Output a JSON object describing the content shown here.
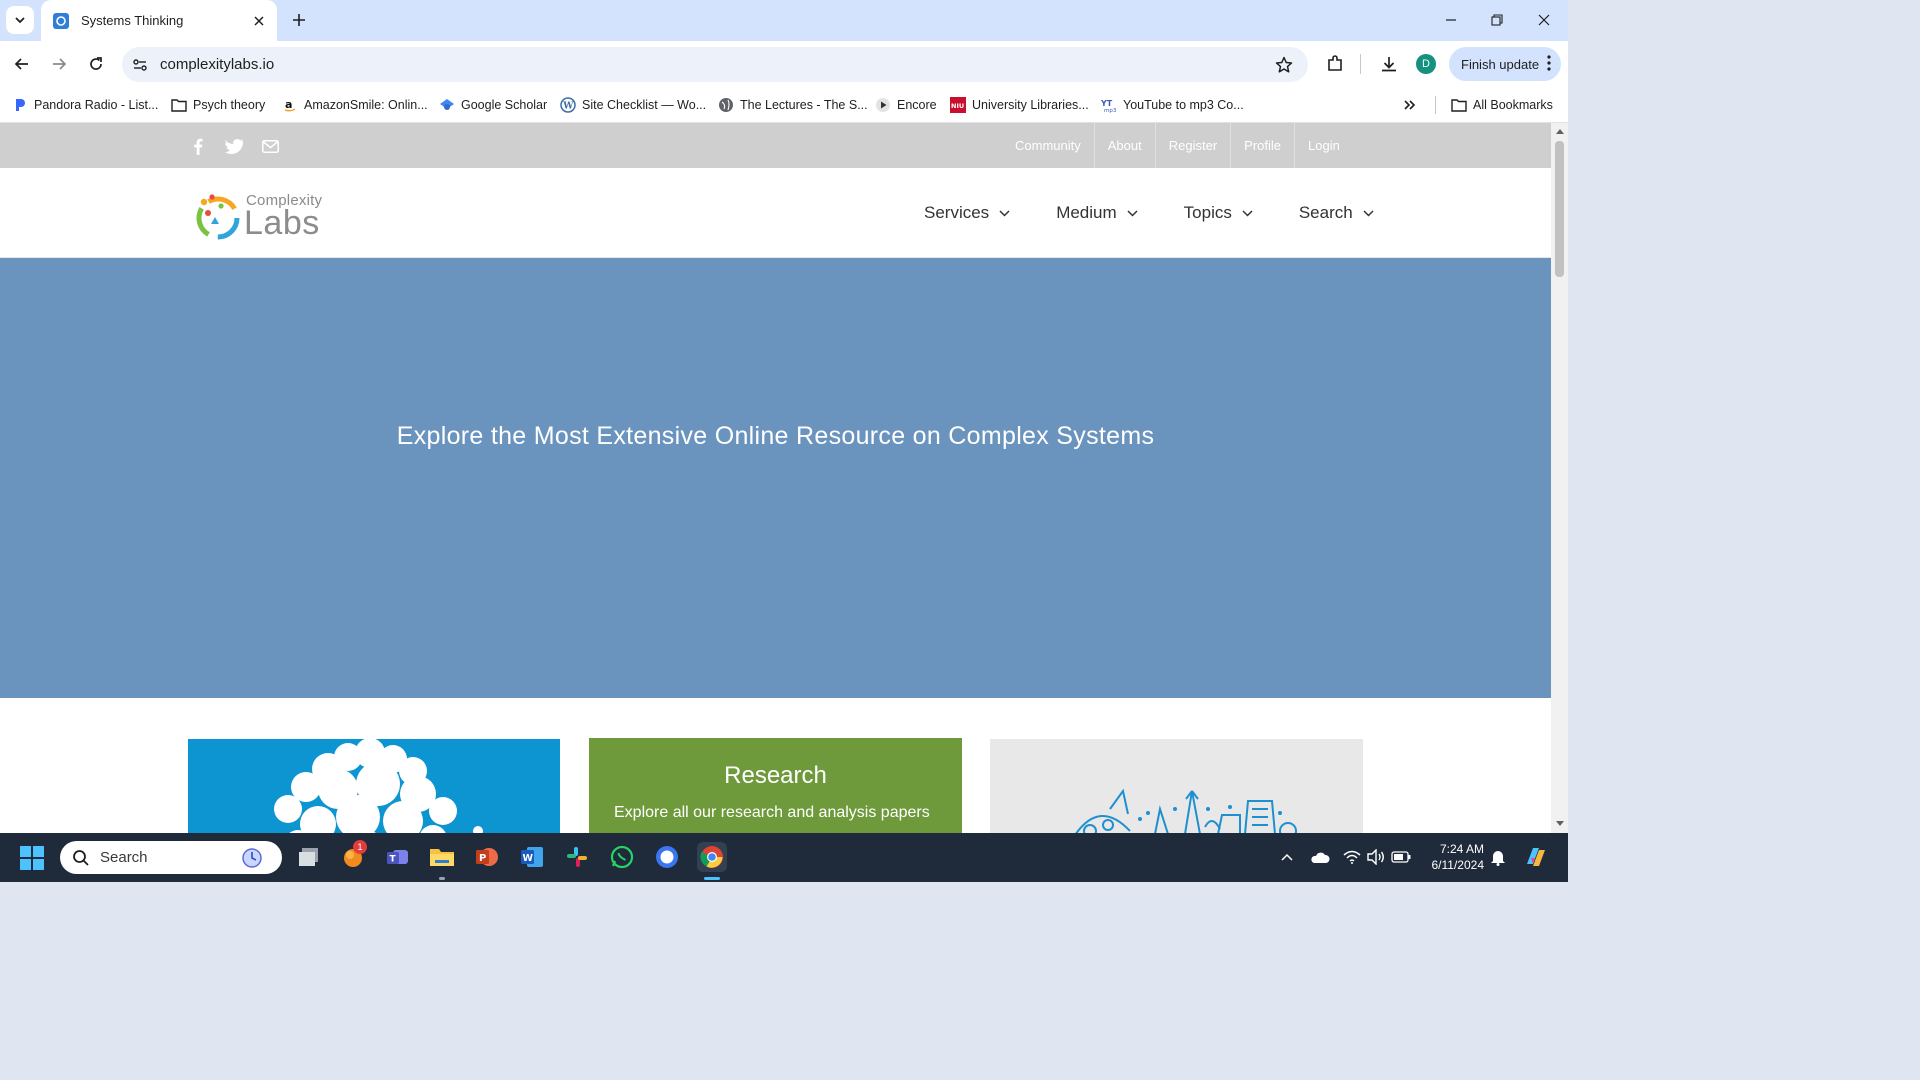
{
  "browser": {
    "tab": {
      "title": "Systems Thinking"
    },
    "address": {
      "url": "complexitylabs.io"
    },
    "profile_initial": "D",
    "finish_update_label": "Finish update",
    "bookmarks": [
      {
        "label": "Pandora Radio - List...",
        "icon": "pandora-icon"
      },
      {
        "label": "Psych theory",
        "icon": "folder-icon"
      },
      {
        "label": "AmazonSmile: Onlin...",
        "icon": "amazon-icon"
      },
      {
        "label": "Google Scholar",
        "icon": "scholar-icon"
      },
      {
        "label": "Site Checklist — Wo...",
        "icon": "wordpress-icon"
      },
      {
        "label": "The Lectures - The S...",
        "icon": "globe-icon"
      },
      {
        "label": "Encore",
        "icon": "play-icon"
      },
      {
        "label": "University Libraries...",
        "icon": "niu-icon"
      },
      {
        "label": "YouTube to mp3 Co...",
        "icon": "mp3-icon"
      }
    ],
    "all_bookmarks_label": "All Bookmarks"
  },
  "site": {
    "toplinks": [
      "Community",
      "About",
      "Register",
      "Profile",
      "Login"
    ],
    "logo": {
      "top": "Complexity",
      "main": "Labs"
    },
    "nav": [
      "Services",
      "Medium",
      "Topics",
      "Search"
    ],
    "hero": {
      "title": "Explore the Most Extensive Online Resource on Complex Systems"
    },
    "cards": [
      {
        "title": "",
        "description": ""
      },
      {
        "title": "Research",
        "description": "Explore all our research and analysis papers"
      },
      {
        "title": "",
        "description": ""
      }
    ]
  },
  "taskbar": {
    "search_label": "Search",
    "notification_count": "1",
    "time": "7:24 AM",
    "date": "6/11/2024"
  },
  "colors": {
    "hero": "#6a94bd",
    "card_blue": "#0c95d0",
    "card_green": "#6e9a3c",
    "topbar": "#cfcfcf",
    "chrome_tabstrip": "#d3e3fd"
  }
}
